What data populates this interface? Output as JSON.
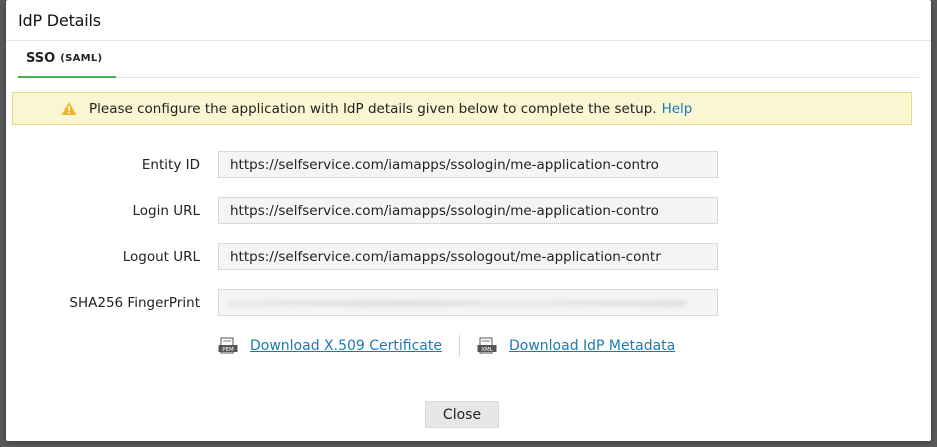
{
  "modal": {
    "title": "IdP Details",
    "tab": {
      "main": "SSO",
      "sub": "(SAML)"
    },
    "alert": {
      "icon": "warning-icon",
      "text": "Please configure the application with IdP details given below to complete the setup.",
      "help_link": "Help"
    },
    "fields": [
      {
        "label": "Entity ID",
        "value": "https://selfservice.com/iamapps/ssologin/me-application-contro"
      },
      {
        "label": "Login URL",
        "value": "https://selfservice.com/iamapps/ssologin/me-application-contro"
      },
      {
        "label": "Logout URL",
        "value": "https://selfservice.com/iamapps/ssologout/me-application-contr"
      },
      {
        "label": "SHA256 FingerPrint",
        "value": ""
      }
    ],
    "downloads": {
      "certificate": {
        "icon": "pem-file-icon",
        "label": "Download X.509 Certificate"
      },
      "metadata": {
        "icon": "xml-file-icon",
        "label": "Download IdP Metadata"
      }
    },
    "close_label": "Close"
  },
  "colors": {
    "accent": "#4caf50",
    "link": "#1a7ab8",
    "alert_bg": "#fbf6d2"
  }
}
